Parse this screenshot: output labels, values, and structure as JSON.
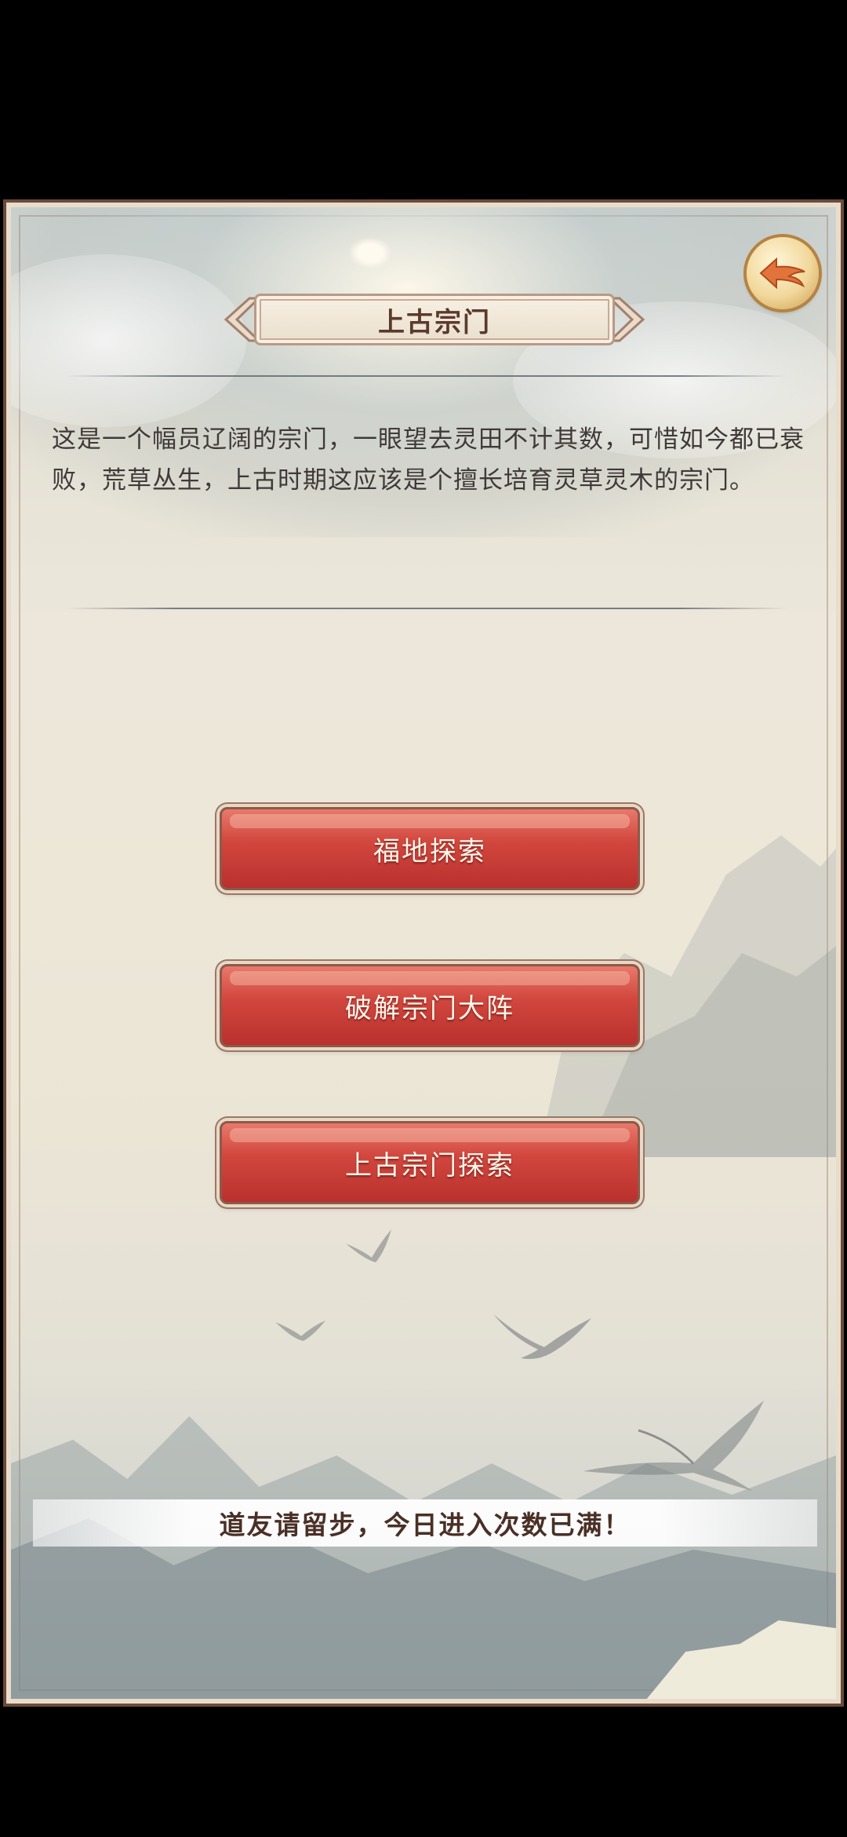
{
  "header": {
    "title": "上古宗门",
    "back_icon": "back-arrow-icon"
  },
  "description": "这是一个幅员辽阔的宗门，一眼望去灵田不计其数，可惜如今都已衰败，荒草丛生，上古时期这应该是个擅长培育灵草灵木的宗门。",
  "actions": [
    {
      "label": "福地探索"
    },
    {
      "label": "破解宗门大阵"
    },
    {
      "label": "上古宗门探索"
    }
  ],
  "notice": "道友请留步，今日进入次数已满！",
  "colors": {
    "button_red": "#d2483f",
    "accent_gold": "#f1d79a",
    "text_brown": "#5b3a2c",
    "frame": "#e9dccb"
  }
}
